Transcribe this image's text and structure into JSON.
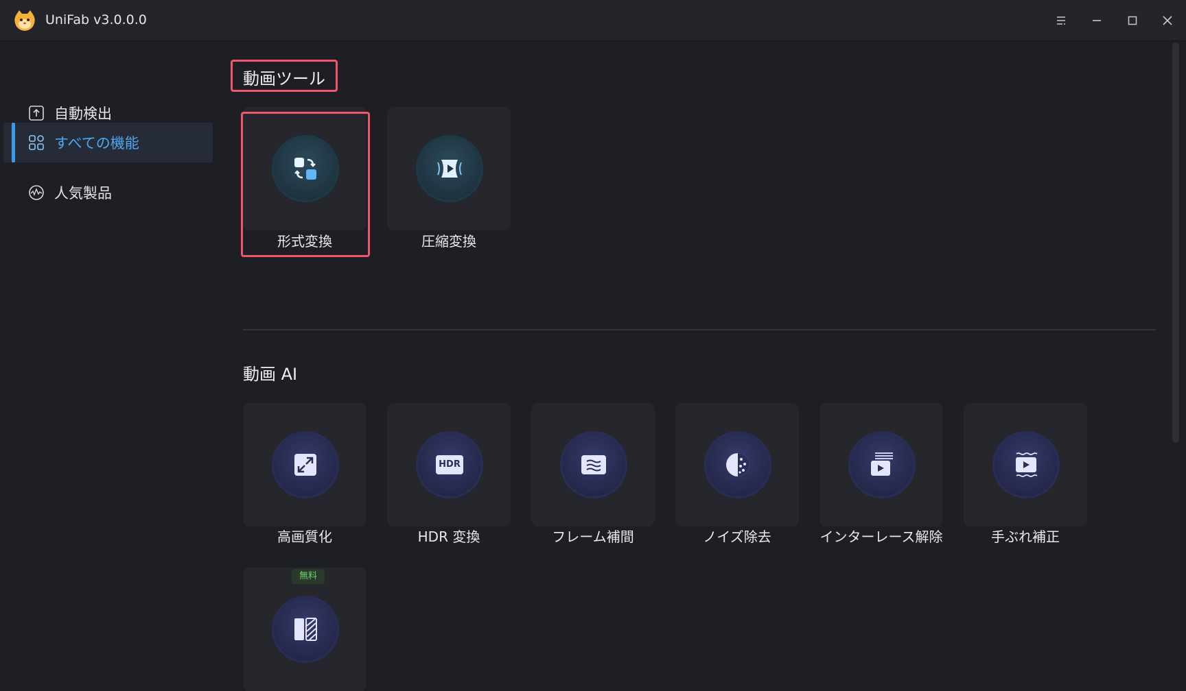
{
  "app": {
    "title": "UniFab v3.0.0.0"
  },
  "sidebar": {
    "items": [
      {
        "label": "自動検出",
        "icon": "upload-box-icon",
        "active": false
      },
      {
        "label": "すべての機能",
        "icon": "grid-icon",
        "active": true
      },
      {
        "label": "人気製品",
        "icon": "activity-icon",
        "active": false
      }
    ]
  },
  "sections": {
    "video_tools": {
      "title": "動画ツール",
      "cards": [
        {
          "label": "形式変換",
          "icon": "convert-icon"
        },
        {
          "label": "圧縮変換",
          "icon": "compress-icon"
        }
      ]
    },
    "video_ai": {
      "title": "動画 AI",
      "cards": [
        {
          "label": "高画質化",
          "icon": "upscale-icon"
        },
        {
          "label": "HDR 変換",
          "icon": "hdr-icon",
          "icon_text": "HDR"
        },
        {
          "label": "フレーム補間",
          "icon": "frame-interpolation-icon"
        },
        {
          "label": "ノイズ除去",
          "icon": "denoise-icon"
        },
        {
          "label": "インターレース解除",
          "icon": "deinterlace-icon"
        },
        {
          "label": "手ぶれ補正",
          "icon": "stabilize-icon"
        },
        {
          "label": "",
          "icon": "compare-icon",
          "badge": "無料"
        }
      ]
    }
  },
  "colors": {
    "accent": "#3a9bea",
    "highlight": "#f0576a",
    "badge": "#6cd06c"
  }
}
